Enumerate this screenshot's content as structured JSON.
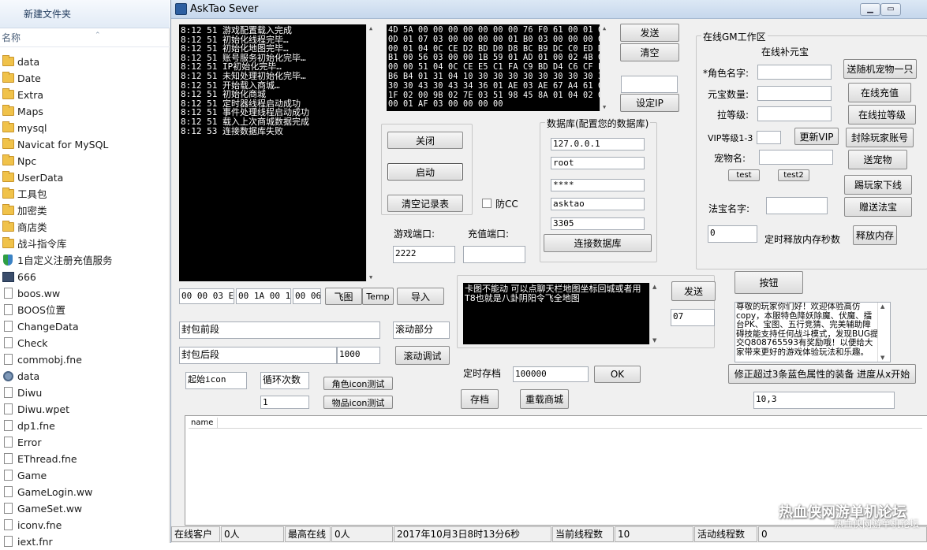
{
  "explorer": {
    "new_folder": "新建文件夹",
    "column_name": "名称",
    "items": [
      {
        "label": "data",
        "icon": "folder-icon",
        "type": "folder"
      },
      {
        "label": "Date",
        "icon": "folder-icon",
        "type": "folder"
      },
      {
        "label": "Extra",
        "icon": "folder-icon",
        "type": "folder"
      },
      {
        "label": "Maps",
        "icon": "folder-icon",
        "type": "folder"
      },
      {
        "label": "mysql",
        "icon": "folder-icon",
        "type": "folder"
      },
      {
        "label": "Navicat for MySQL",
        "icon": "folder-icon",
        "type": "folder"
      },
      {
        "label": "Npc",
        "icon": "folder-icon",
        "type": "folder"
      },
      {
        "label": "UserData",
        "icon": "folder-icon",
        "type": "folder"
      },
      {
        "label": "工具包",
        "icon": "folder-icon",
        "type": "folder"
      },
      {
        "label": "加密类",
        "icon": "folder-icon",
        "type": "folder"
      },
      {
        "label": "商店类",
        "icon": "folder-icon",
        "type": "folder"
      },
      {
        "label": "战斗指令库",
        "icon": "folder-icon",
        "type": "folder"
      },
      {
        "label": "1自定义注册充值服务",
        "icon": "shield-icon",
        "type": "shield"
      },
      {
        "label": "666",
        "icon": "exe-icon",
        "type": "exe"
      },
      {
        "label": "boos.ww",
        "icon": "file-icon",
        "type": "file"
      },
      {
        "label": "BOOS位置",
        "icon": "file-icon",
        "type": "file"
      },
      {
        "label": "ChangeData",
        "icon": "file-icon",
        "type": "file"
      },
      {
        "label": "Check",
        "icon": "file-icon",
        "type": "file"
      },
      {
        "label": "commobj.fne",
        "icon": "file-icon",
        "type": "file"
      },
      {
        "label": "data",
        "icon": "gear-icon",
        "type": "gear"
      },
      {
        "label": "Diwu",
        "icon": "file-icon",
        "type": "file"
      },
      {
        "label": "Diwu.wpet",
        "icon": "file-icon",
        "type": "file"
      },
      {
        "label": "dp1.fne",
        "icon": "file-icon",
        "type": "file"
      },
      {
        "label": "Error",
        "icon": "file-icon",
        "type": "file"
      },
      {
        "label": "EThread.fne",
        "icon": "file-icon",
        "type": "file"
      },
      {
        "label": "Game",
        "icon": "file-icon",
        "type": "file"
      },
      {
        "label": "GameLogin.ww",
        "icon": "file-icon",
        "type": "file"
      },
      {
        "label": "GameSet.ww",
        "icon": "file-icon",
        "type": "file"
      },
      {
        "label": "iconv.fne",
        "icon": "file-icon",
        "type": "file"
      },
      {
        "label": "iext.fnr",
        "icon": "file-icon",
        "type": "file"
      }
    ]
  },
  "window": {
    "title": "AskTao Sever",
    "min": "▁",
    "max": "▭",
    "close": "✕"
  },
  "log": {
    "lines": [
      "8:12 51   游戏配置载入完成",
      "8:12 51   初始化线程完毕…",
      "8:12 51   初始化地图完毕…",
      "8:12 51   账号服务初始化完毕…",
      "8:12 51   IP初始化完毕…",
      "8:12 51   未知处理初始化完毕…",
      "8:12 51   开始载入商城…",
      "8:12 51   初始化商城",
      "8:12 51   定时器线程启动成功",
      "8:12 51   事件处理线程启动成功",
      "8:12 51   载入上次商城数据完成",
      "8:12 53   连接数据库失败"
    ]
  },
  "hex": {
    "lines": [
      "4D 5A 00 00 00 00 00 00 00 76 F0 61 00 01 00",
      "0D 01 07 03 00 00 00 00 01 B0 03 00 00 00 00",
      "00 01 04 0C CE D2 BD D0 D8 BC B9 DC C0 ED D4",
      "B1 00 56 03 00 00 1B 59 01 AD 01 00 02 4B 04",
      "00 00 51 04 0C CE E5 C1 FA C9 BD D4 C6 CF F6",
      "B6 B4 01 31 04 10 30 30 30 30 30 30 30 30 30",
      "30 30 43 30 43 34 36 01 AE 03 AE 67 A4 61 00",
      "1F 02 00 9B 02 7E 03 51 98 45 8A 01 04 02 00",
      "00 01 AF 03 00 00 00 00"
    ]
  },
  "top_buttons": {
    "send": "发送",
    "clear": "清空",
    "set_ip": "设定IP",
    "ip_value": ""
  },
  "controls": {
    "close": "关闭",
    "start": "启动",
    "clear_log": "清空记录表",
    "anti_cc": "防CC",
    "anti_cc_checked": false
  },
  "db": {
    "title": "数据库(配置您的数据库)",
    "host": "127.0.0.1",
    "user": "root",
    "password": "****",
    "name": "asktao",
    "port": "3305",
    "connect": "连接数据库"
  },
  "ports": {
    "game_label": "游戏端口:",
    "game_value": "2222",
    "pay_label": "充值端口:",
    "pay_value": ""
  },
  "gm": {
    "title": "在线GM工作区",
    "subtitle": "在线补元宝",
    "role_label": "*角色名字:",
    "role_value": "",
    "yuanbao_label": "元宝数量:",
    "yuanbao_value": "",
    "level_label": "拉等级:",
    "level_value": "",
    "vip_label": "VIP等级1-3",
    "vip_value": "",
    "pet_label": "宠物名:",
    "pet_value": "",
    "treasure_label": "法宝名字:",
    "treasure_value": "",
    "mem_value": "0",
    "mem_label": "定时释放内存秒数",
    "btn_send_pet_random": "送随机宠物一只",
    "btn_online_recharge": "在线充值",
    "btn_online_level": "在线拉等级",
    "btn_update_vip": "更新VIP",
    "btn_ban": "封除玩家账号",
    "btn_send_pet": "送宠物",
    "btn_test": "test",
    "btn_test2": "test2",
    "btn_kick": "踢玩家下线",
    "btn_gift_treasure": "赠送法宝",
    "btn_release_mem": "释放内存"
  },
  "hexrow": {
    "f1": "00 00 03 EE",
    "f2": "00 1A 00 1A",
    "f3": "00 06",
    "btn_fly": "飞图",
    "btn_temp": "Temp",
    "btn_import": "导入"
  },
  "packet": {
    "front": "封包前段",
    "scroll_part": "滚动部分",
    "back": "封包后段",
    "count": "1000",
    "scroll_debug": "滚动调试",
    "start_icon": "起始icon",
    "loop_count": "循环次数",
    "loop_value": "1",
    "role_icon_test": "角色icon测试",
    "item_icon_test": "物品icon测试"
  },
  "broadcast": {
    "text": "卡图不能动 可以点聊天栏地图坐标回城或者用T8也就是八卦阴阳令飞全地图",
    "send": "发送",
    "channel": "07",
    "timed_save_label": "定时存档",
    "timed_save_value": "100000",
    "ok": "OK",
    "save": "存档",
    "reload_shop": "重载商城"
  },
  "right_panel": {
    "button": "按钮",
    "notice": "尊敬的玩家你们好！欢迎体验高仿copy，本服特色降妖除魔、伏魔、擂台PK、宝图、五行竞猜、完美辅助障碍技能支持任何战斗模式，发现BUG提交Q808765593有奖励哦！以便给大家带来更好的游戏体验玩法和乐趣。",
    "fix_equip": "修正超过3条蓝色属性的装备 进度从x开始",
    "progress_value": "10,3"
  },
  "table": {
    "columns": [
      "name"
    ]
  },
  "status": {
    "online_label": "在线客户",
    "online_value": "0人",
    "max_label": "最高在线",
    "max_value": "0人",
    "datetime": "2017年10月3日8时13分6秒",
    "threads_label": "当前线程数",
    "threads_value": "10",
    "active_label": "活动线程数",
    "active_value": "0"
  },
  "watermark": {
    "line1": "热血侠网游单机论坛",
    "line2": "热血侠网游单机论坛"
  }
}
